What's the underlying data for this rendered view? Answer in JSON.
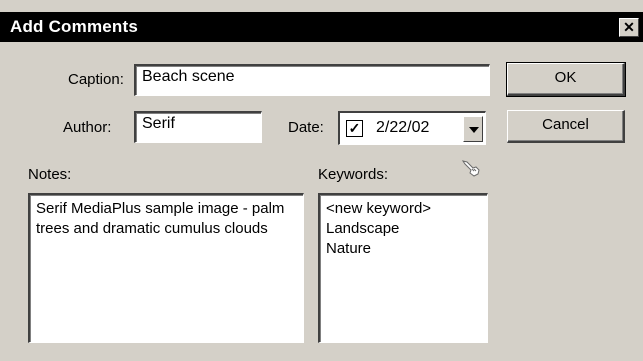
{
  "window": {
    "title": "Add Comments",
    "close_glyph": "✕"
  },
  "form": {
    "caption_label": "Caption:",
    "caption_value": "Beach scene",
    "author_label": "Author:",
    "author_value": "Serif",
    "date_label": "Date:",
    "date_checked": true,
    "date_check_glyph": "✓",
    "date_value": "2/22/02",
    "notes_label": "Notes:",
    "notes_value": "Serif MediaPlus sample image - palm trees and dramatic cumulus clouds",
    "keywords_label": "Keywords:",
    "keywords": [
      "<new keyword>",
      "Landscape",
      "Nature"
    ]
  },
  "buttons": {
    "ok_label": "OK",
    "cancel_label": "Cancel"
  },
  "icons": {
    "keywords_pointer": "hand-pointer-icon"
  },
  "colors": {
    "titlebar": "#000000",
    "dialog_bg": "#d4d0c8",
    "field_bg": "#ffffff"
  }
}
